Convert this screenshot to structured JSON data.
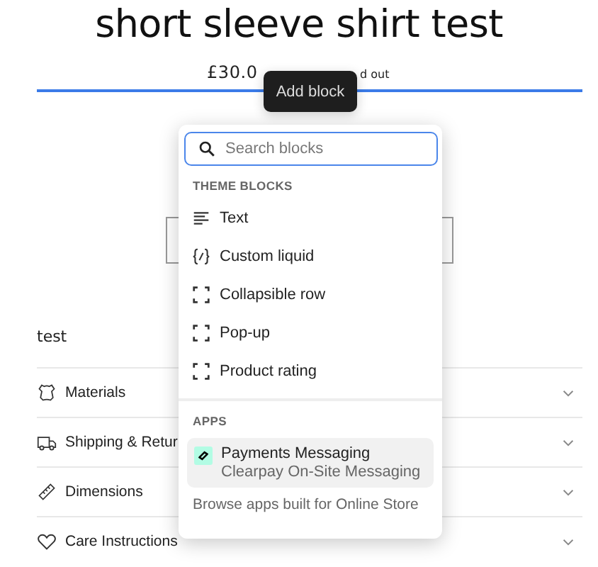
{
  "product": {
    "title": "short sleeve shirt test",
    "price": "£30.0",
    "price_tail": "d out",
    "description": "test"
  },
  "tooltip": {
    "text": "Add block"
  },
  "block_picker": {
    "search": {
      "placeholder": "Search blocks"
    },
    "sections": [
      {
        "heading": "THEME BLOCKS",
        "items": [
          {
            "label": "Text",
            "kind": "text"
          },
          {
            "label": "Custom liquid",
            "kind": "liquid"
          },
          {
            "label": "Collapsible row",
            "kind": "frame"
          },
          {
            "label": "Pop-up",
            "kind": "frame"
          },
          {
            "label": "Product rating",
            "kind": "frame"
          }
        ]
      },
      {
        "heading": "APPS",
        "items": [
          {
            "label": "Payments Messaging",
            "sublabel": "Clearpay On-Site Messaging",
            "kind": "app",
            "selected": true
          }
        ]
      }
    ],
    "footer_link": "Browse apps built for Online Store"
  },
  "accordion": [
    {
      "title": "Materials",
      "kind": "leather",
      "expanded": false
    },
    {
      "title": "Shipping & Retur",
      "kind": "truck",
      "expanded": false
    },
    {
      "title": "Dimensions",
      "kind": "ruler",
      "expanded": false
    },
    {
      "title": "Care Instructions",
      "kind": "heart",
      "expanded": false
    }
  ]
}
